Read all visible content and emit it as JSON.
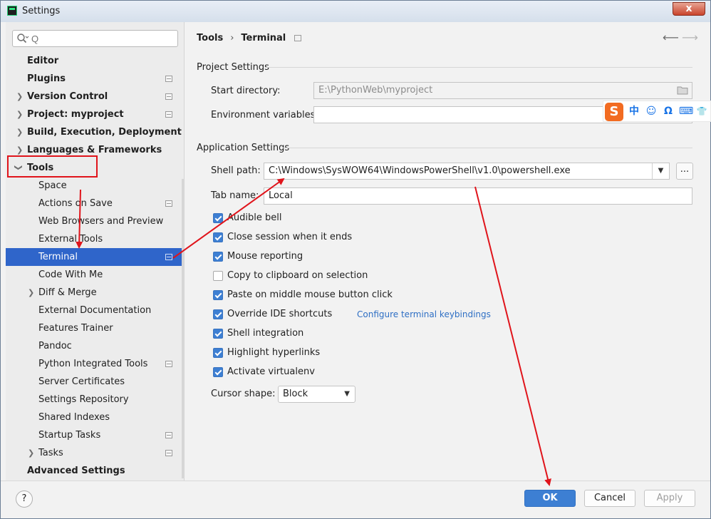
{
  "window": {
    "title": "Settings",
    "close_label": "x"
  },
  "search": {
    "placeholder": "Q"
  },
  "sidebar": {
    "items": [
      {
        "label": "Editor"
      },
      {
        "label": "Plugins"
      },
      {
        "label": "Version Control"
      },
      {
        "label": "Project: myproject"
      },
      {
        "label": "Build, Execution, Deployment"
      },
      {
        "label": "Languages & Frameworks"
      },
      {
        "label": "Tools"
      },
      {
        "label": "Space"
      },
      {
        "label": "Actions on Save"
      },
      {
        "label": "Web Browsers and Preview"
      },
      {
        "label": "External Tools"
      },
      {
        "label": "Terminal"
      },
      {
        "label": "Code With Me"
      },
      {
        "label": "Diff & Merge"
      },
      {
        "label": "External Documentation"
      },
      {
        "label": "Features Trainer"
      },
      {
        "label": "Pandoc"
      },
      {
        "label": "Python Integrated Tools"
      },
      {
        "label": "Server Certificates"
      },
      {
        "label": "Settings Repository"
      },
      {
        "label": "Shared Indexes"
      },
      {
        "label": "Startup Tasks"
      },
      {
        "label": "Tasks"
      },
      {
        "label": "Advanced Settings"
      }
    ]
  },
  "breadcrumb": {
    "parent": "Tools",
    "current": "Terminal"
  },
  "project_settings": {
    "title": "Project Settings",
    "start_dir_label": "Start directory:",
    "start_dir_value": "E:\\PythonWeb\\myproject",
    "env_label": "Environment variables:",
    "env_value": ""
  },
  "app_settings": {
    "title": "Application Settings",
    "shell_label": "Shell path:",
    "shell_value": "C:\\Windows\\SysWOW64\\WindowsPowerShell\\v1.0\\powershell.exe",
    "browse_label": "...",
    "tab_label": "Tab name:",
    "tab_value": "Local",
    "checks": [
      {
        "label": "Audible bell",
        "checked": true
      },
      {
        "label": "Close session when it ends",
        "checked": true
      },
      {
        "label": "Mouse reporting",
        "checked": true
      },
      {
        "label": "Copy to clipboard on selection",
        "checked": false
      },
      {
        "label": "Paste on middle mouse button click",
        "checked": true
      },
      {
        "label": "Override IDE shortcuts",
        "checked": true
      },
      {
        "label": "Shell integration",
        "checked": true
      },
      {
        "label": "Highlight hyperlinks",
        "checked": true
      },
      {
        "label": "Activate virtualenv",
        "checked": true
      }
    ],
    "keybindings_link": "Configure terminal keybindings",
    "cursor_label": "Cursor shape:",
    "cursor_value": "Block"
  },
  "ime": {
    "logo": "S",
    "items": [
      "中",
      "☺",
      "Ω",
      "⌨",
      "👕"
    ]
  },
  "buttons": {
    "help": "?",
    "ok": "OK",
    "cancel": "Cancel",
    "apply": "Apply"
  },
  "colors": {
    "accent": "#3d7fd3",
    "selection": "#2f65ca",
    "annotation": "#e0141b"
  }
}
